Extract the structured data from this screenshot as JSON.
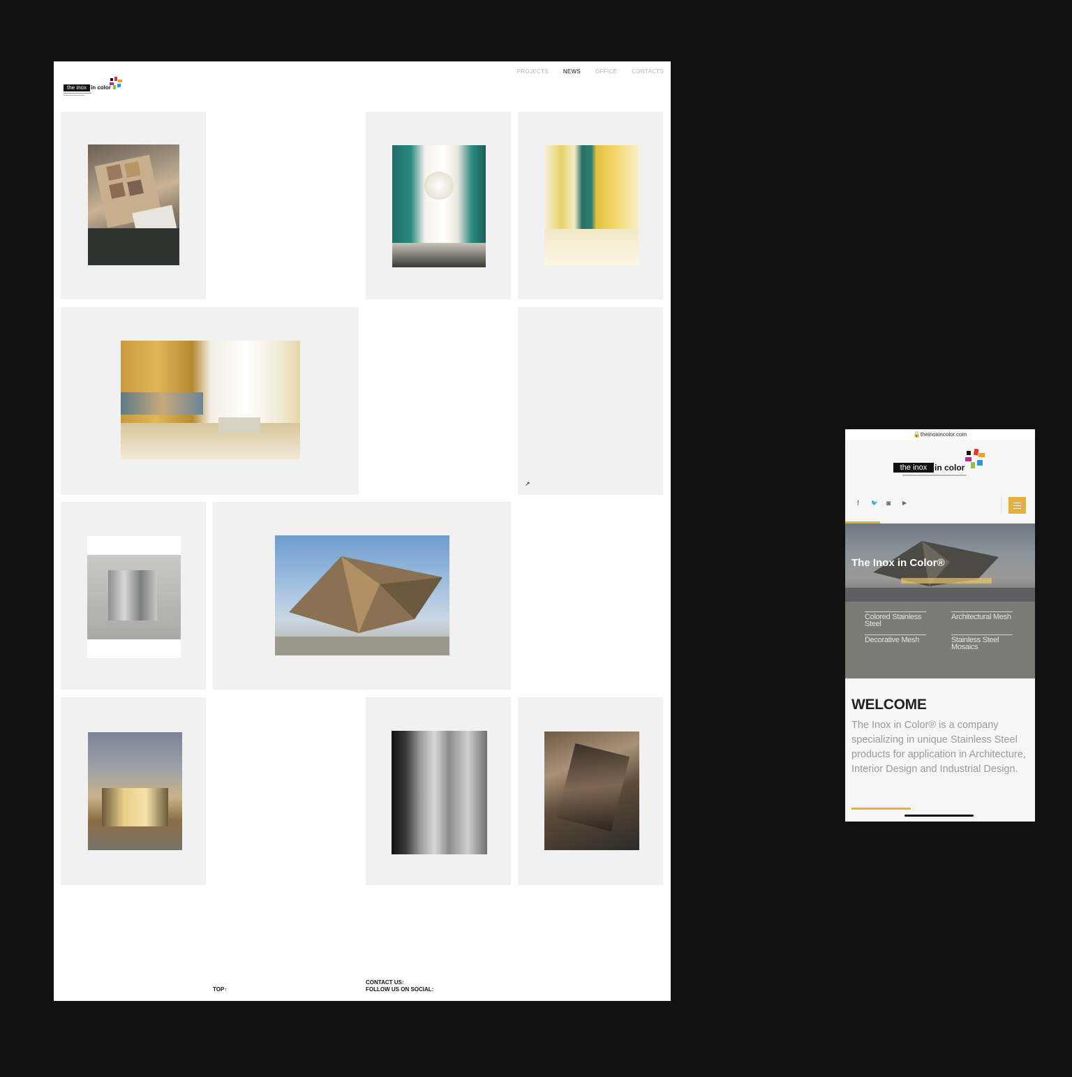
{
  "desktop": {
    "logo": {
      "boxed_text": "the inox",
      "rest_text": "in color"
    },
    "nav": [
      {
        "label": "PROJECTS",
        "active": false
      },
      {
        "label": "NEWS",
        "active": true
      },
      {
        "label": "OFFICE",
        "active": false
      },
      {
        "label": "CONTACTS",
        "active": false
      }
    ],
    "external_arrow": "↗",
    "footer": {
      "top_link": "TOP↑",
      "contact_label": "CONTACT US:",
      "social_label": "FOLLOW US ON SOCIAL:"
    }
  },
  "mobile": {
    "url": "🔒theinoxincolor.com",
    "logo": {
      "boxed_text": "the inox",
      "rest_text": "in color"
    },
    "social_icons": [
      "facebook-icon",
      "twitter-icon",
      "instagram-icon",
      "youtube-icon"
    ],
    "social_glyphs": [
      "f",
      "🐦",
      "◙",
      "▶"
    ],
    "hero_title": "The Inox in Color®",
    "categories": [
      "Colored Stainless Steel",
      "Architectural Mesh",
      "Decorative Mesh",
      "Stainless Steel Mosaics"
    ],
    "welcome_title": "WELCOME",
    "welcome_text": "The Inox in Color® is a company specializing in unique Stainless Steel products for application in Architecture, Interior Design and Industrial Design.",
    "accent_color": "#e8ae3c"
  }
}
